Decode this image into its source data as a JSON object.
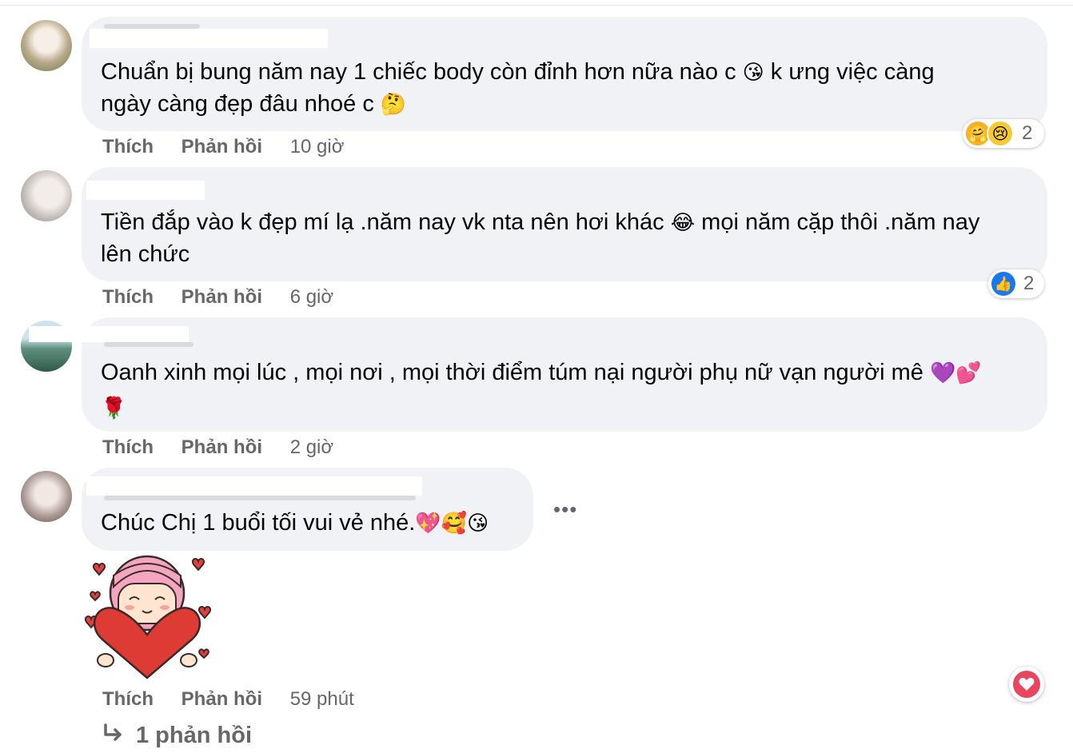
{
  "comments": [
    {
      "lines": [
        "Chuẩn bị bung năm nay 1 chiếc body còn đỉnh hơn nữa nào c ",
        " k ưng việc càng",
        "ngày càng đẹp đâu nhoé c "
      ],
      "emoji": [
        "😘",
        "🤔"
      ],
      "like_label": "Thích",
      "reply_label": "Phản hồi",
      "time": "10 giờ",
      "reactions": {
        "icons": [
          "care-reaction-icon",
          "sad-reaction-icon"
        ],
        "count": "2"
      }
    },
    {
      "lines": [
        "Tiền đắp vào k đẹp mí lạ .năm nay vk nta nên hơi khác ",
        " mọi năm cặp thôi .năm nay",
        "lên chức"
      ],
      "emoji": [
        "😂"
      ],
      "like_label": "Thích",
      "reply_label": "Phản hồi",
      "time": "6 giờ",
      "reactions": {
        "icons": [
          "like-reaction-icon"
        ],
        "count": "2"
      }
    },
    {
      "lines": [
        "Oanh xinh mọi lúc , mọi nơi , mọi thời điểm túm nại người phụ nữ vạn người mê "
      ],
      "emoji": [
        "💜💕",
        "🌹"
      ],
      "like_label": "Thích",
      "reply_label": "Phản hồi",
      "time": "2 giờ"
    },
    {
      "lines": [
        "Chúc Chị 1 buổi tối vui vẻ nhé."
      ],
      "emoji": [
        "💖🥰😘"
      ],
      "like_label": "Thích",
      "reply_label": "Phản hồi",
      "time": "59 phút",
      "more_label": "•••"
    }
  ],
  "replies_link": "1 phản hồi",
  "colors": {
    "bubble": "#f0f2f5",
    "meta": "#65676b",
    "like": "#1877f2",
    "heart": "#e8465f"
  }
}
